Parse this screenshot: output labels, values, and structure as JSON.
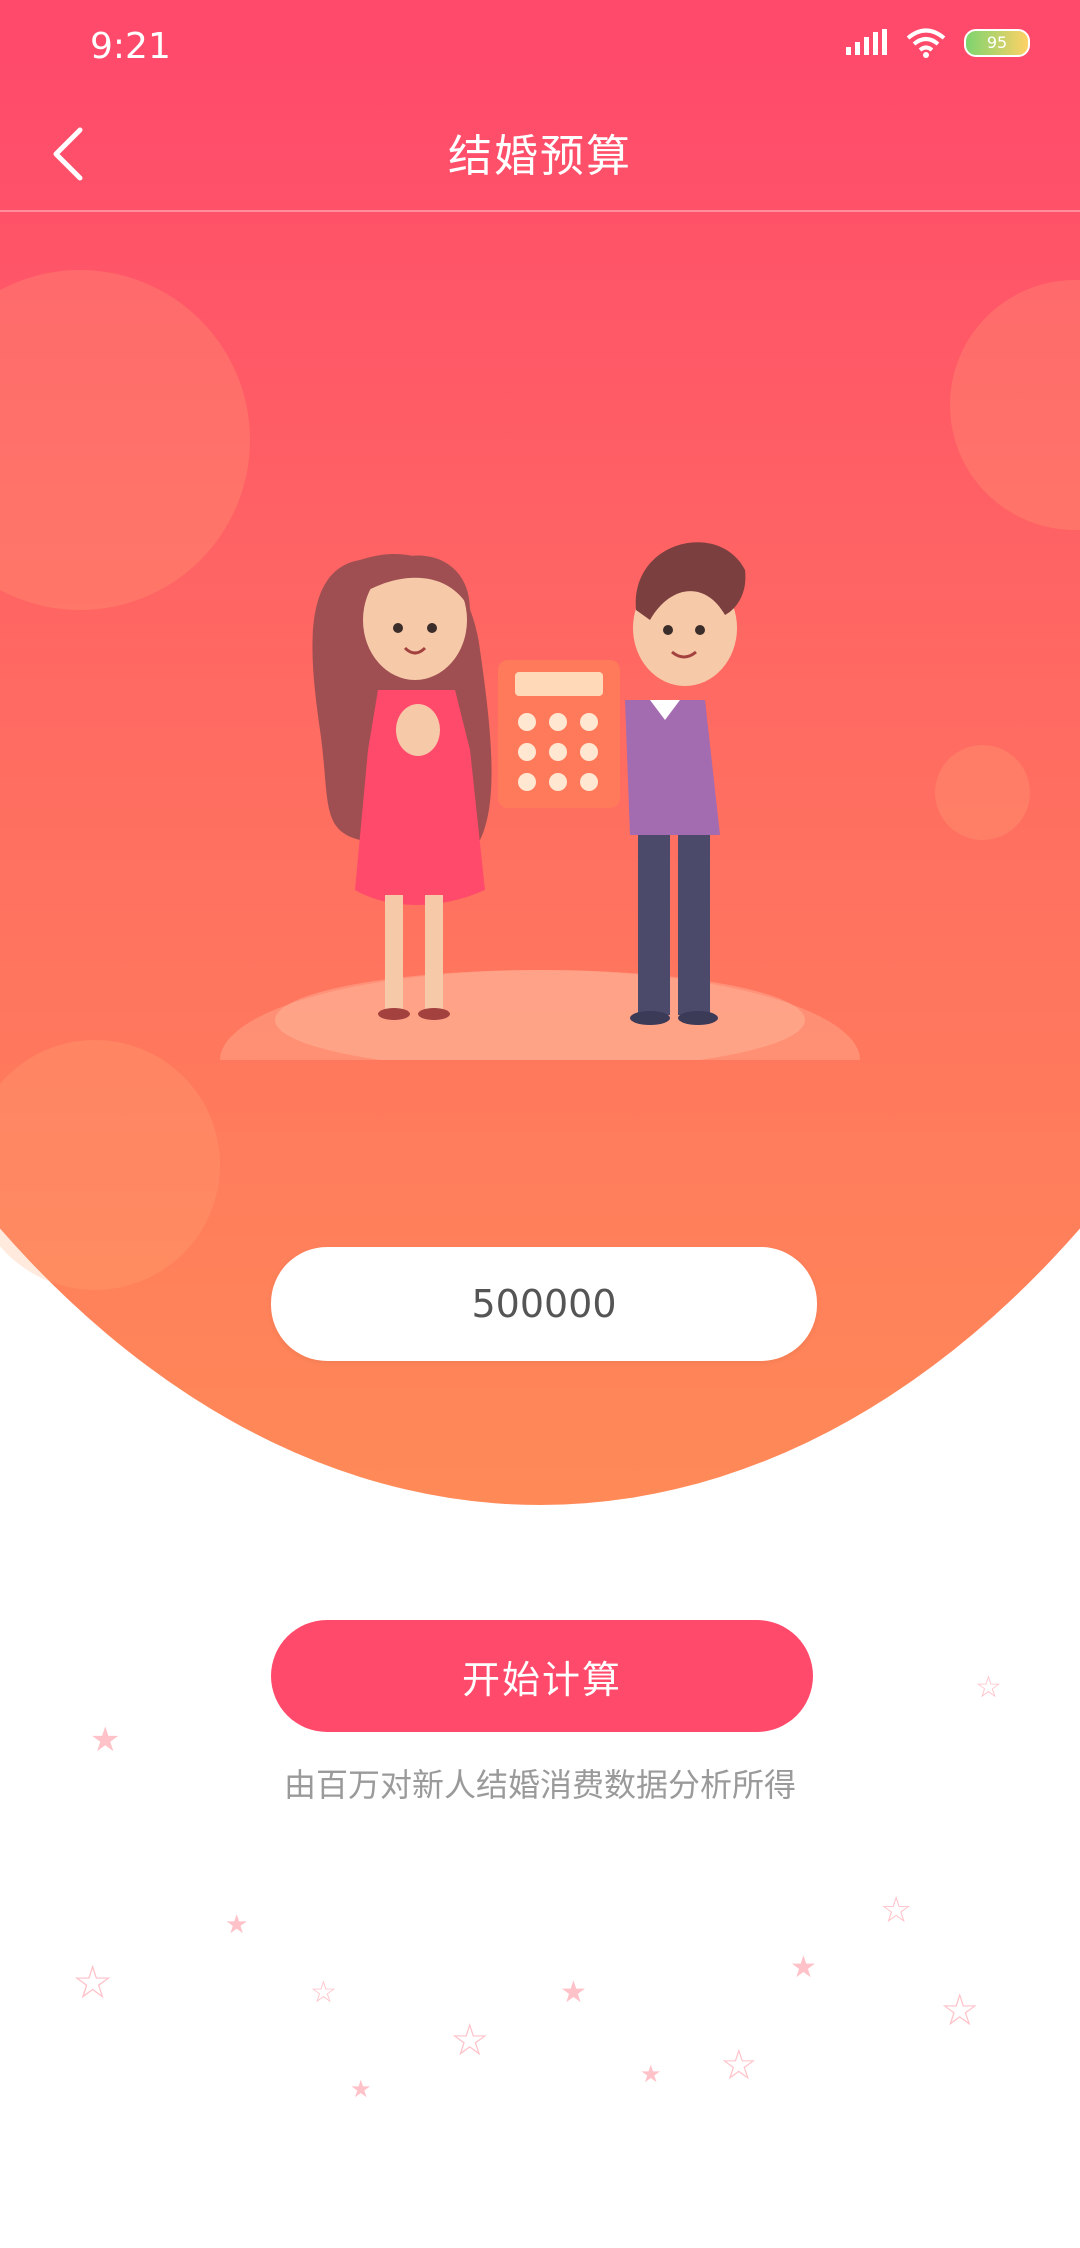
{
  "status_bar": {
    "time": "9:21",
    "battery_level": "95"
  },
  "header": {
    "title": "结婚预算"
  },
  "amount_input": {
    "value": "500000"
  },
  "actions": {
    "start_label": "开始计算"
  },
  "footnote": "由百万对新人结婚消费数据分析所得",
  "colors": {
    "primary": "#ff4a6b",
    "accent": "#ff8a57"
  },
  "icons": [
    "back-chevron-icon",
    "signal-icon",
    "wifi-icon",
    "battery-icon",
    "calculator-icon"
  ]
}
